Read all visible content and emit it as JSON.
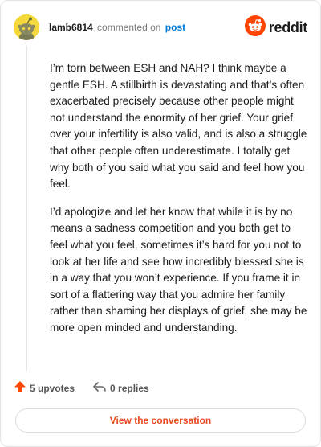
{
  "header": {
    "username": "lamb6814",
    "commented_on": "commented on",
    "post_link": "post",
    "brand": "reddit"
  },
  "comment": {
    "paragraphs": [
      "I’m torn between ESH and NAH? I think maybe a gentle ESH. A stillbirth is devastating and that’s often exacerbated precisely because other people might not understand the enormity of her grief. Your grief over your infertility is also valid, and is also a struggle that other people often underestimate. I totally get why both of you said what you said and feel how you feel.",
      "I’d apologize and let her know that while it is by no means a sadness competition and you both get to feel what you feel, sometimes it’s hard for you not to look at her life and see how incredibly blessed she is in a way that you won’t experience. If you frame it in sort of a flattering way that you admire her family rather than shaming her displays of grief, she may be more open minded and understanding."
    ]
  },
  "actions": {
    "upvotes": "5 upvotes",
    "replies": "0 replies"
  },
  "view_button": "View the conversation",
  "colors": {
    "reddit_orange": "#ff4500",
    "link_blue": "#0079d3",
    "cta_orange": "#e8491d",
    "avatar_yellow": "#f5d83a"
  },
  "icons": {
    "avatar": "snoo-avatar-icon",
    "brand": "reddit-logo-icon",
    "upvote": "upvote-arrow-icon",
    "reply": "reply-arrow-icon"
  }
}
